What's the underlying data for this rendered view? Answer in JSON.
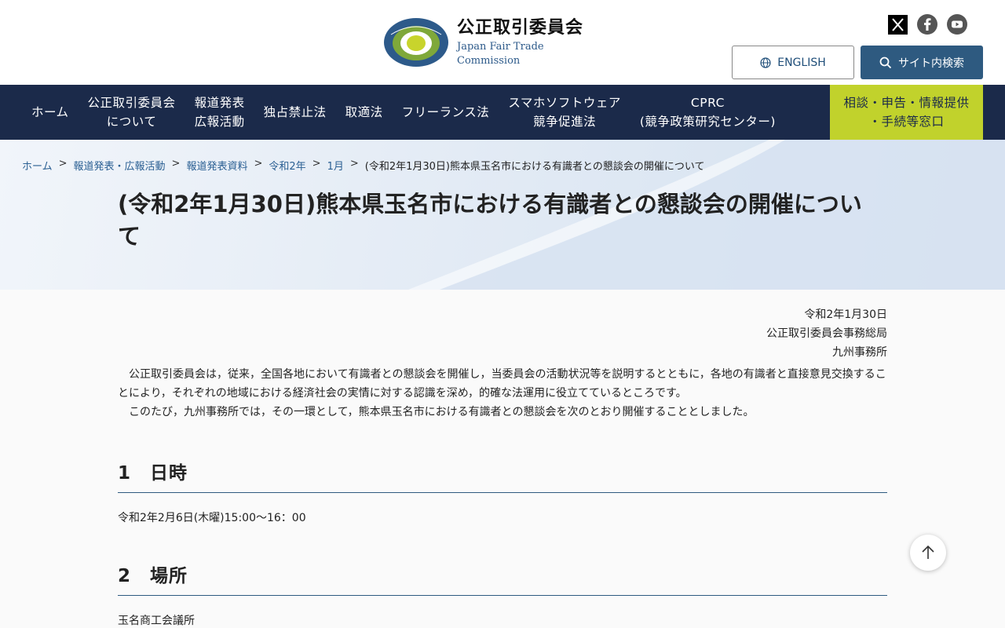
{
  "header": {
    "logo_ja": "公正取引委員会",
    "logo_en": "Japan Fair Trade Commission",
    "english_label": "ENGLISH",
    "search_label": "サイト内検索"
  },
  "nav": {
    "items": [
      {
        "line1": "ホーム",
        "line2": ""
      },
      {
        "line1": "公正取引委員会",
        "line2": "について"
      },
      {
        "line1": "報道発表",
        "line2": "広報活動"
      },
      {
        "line1": "独占禁止法",
        "line2": ""
      },
      {
        "line1": "取適法",
        "line2": ""
      },
      {
        "line1": "フリーランス法",
        "line2": ""
      },
      {
        "line1": "スマホソフトウェア",
        "line2": "競争促進法"
      },
      {
        "line1": "CPRC",
        "line2": "(競争政策研究センター)"
      }
    ],
    "cta_line1": "相談・申告・情報提供",
    "cta_line2": "・手続等窓口"
  },
  "breadcrumb": {
    "items": [
      "ホーム",
      "報道発表・広報活動",
      "報道発表資料",
      "令和2年",
      "1月"
    ],
    "separator": ">",
    "current": "(令和2年1月30日)熊本県玉名市における有識者との懇談会の開催について"
  },
  "page": {
    "title": "(令和2年1月30日)熊本県玉名市における有識者との懇談会の開催について"
  },
  "meta": {
    "date": "令和2年1月30日",
    "office": "公正取引委員会事務総局",
    "branch": "九州事務所"
  },
  "body": {
    "p1": "　公正取引委員会は，従来，全国各地において有識者との懇談会を開催し，当委員会の活動状況等を説明するとともに，各地の有識者と直接意見交換することにより，それぞれの地域における経済社会の実情に対する認識を深め，的確な法運用に役立てているところです。",
    "p2": "　このたび，九州事務所では，その一環として，熊本県玉名市における有識者との懇談会を次のとおり開催することとしました。"
  },
  "sections": [
    {
      "heading": "1　日時",
      "text": "令和2年2月6日(木曜)15:00～16：00"
    },
    {
      "heading": "2　場所",
      "text": "玉名商工会議所"
    }
  ],
  "colors": {
    "nav_bg": "#1b2a4a",
    "cta_bg": "#c1d22c",
    "accent": "#2e5a80"
  }
}
